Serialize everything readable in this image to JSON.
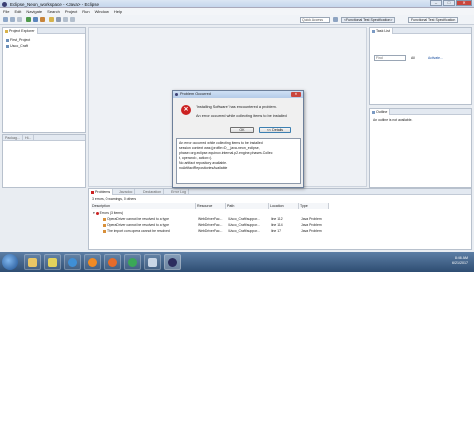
{
  "window": {
    "title": "Eclipse_Neon_workspace - <Java> - Eclipse"
  },
  "menu": [
    "File",
    "Edit",
    "Navigate",
    "Search",
    "Project",
    "Run",
    "Window",
    "Help"
  ],
  "toolbar": {
    "quick_access": "Quick Access",
    "perspective_1": "<Functional Test Specification>",
    "perspective_2": "Functional Test Specification"
  },
  "project_explorer": {
    "tab_label": "Project Explorer",
    "items": [
      "First_Project",
      "Usco_Craft"
    ],
    "bottom_tabs": [
      "Packag...",
      "Hi..."
    ]
  },
  "task_list": {
    "tab_label": "Task List",
    "find_placeholder": "Find",
    "all_label": "All",
    "activate_label": "Activate..."
  },
  "outline": {
    "tab_label": "Outline",
    "message": "An outline is not available."
  },
  "problem_dialog": {
    "title": "Problem Occurred",
    "message": "'Installing Software' has encountered a problem.",
    "detail": "An error occurred while collecting items to be installed",
    "ok_label": "OK",
    "details_label": "<< Details",
    "details_lines": [
      "An error occurred while collecting items to be installed",
      "  session context was:(profile=D__java-neon_eclipse,",
      "  phase=org.eclipse.equinox.internal.p2.engine.phases.Collec",
      "  t, operand=, action=).",
      "  No artifact repository available.",
      "  noArtifactRepositoriesAvailable"
    ]
  },
  "problems_view": {
    "tabs": [
      "Problems",
      "Javadoc",
      "Declaration",
      "Error Log"
    ],
    "summary": "3 errors, 0 warnings, 0 others",
    "columns": [
      "Description",
      "Resource",
      "Path",
      "Location",
      "Type"
    ],
    "group_label": "Errors (3 items)",
    "rows": [
      [
        "OperaDriver cannot be resolved to a type",
        "WebDriverFac...",
        "/Usco_Craft/suppor...",
        "line 112",
        "Java Problem"
      ],
      [
        "OperaDriver cannot be resolved to a type",
        "WebDriverFac...",
        "/Usco_Craft/suppor...",
        "line 114",
        "Java Problem"
      ],
      [
        "The import com.opera cannot be resolved",
        "WebDriverFac...",
        "/Usco_Craft/suppor...",
        "line 17",
        "Java Problem"
      ]
    ]
  },
  "taskbar": {
    "time": "8:46 AM",
    "date": "6/21/2017"
  },
  "icons": {
    "error": "#cc2222",
    "folder": "#d8b24a",
    "project": "#6b8fb8"
  }
}
